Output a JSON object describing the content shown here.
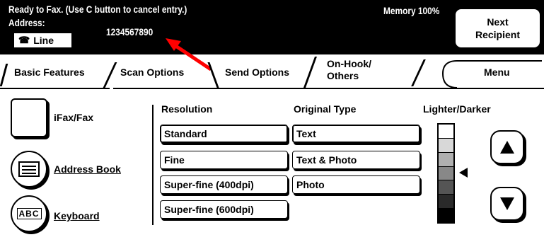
{
  "status": {
    "message": "Ready to Fax.  (Use C button to cancel entry.)",
    "memory": "Memory 100%",
    "address_label": "Address:",
    "address_value": "1234567890",
    "line_label": "Line",
    "next_recipient": "Next\nRecipient"
  },
  "tabs": [
    {
      "label": "Basic Features"
    },
    {
      "label": "Scan Options"
    },
    {
      "label": "Send Options"
    },
    {
      "label": "On-Hook/\nOthers"
    },
    {
      "label": "Menu"
    }
  ],
  "left": {
    "ifax": "iFax/Fax",
    "address_book": "Address Book",
    "keyboard": "Keyboard",
    "keyboard_icon_text": "ABC"
  },
  "resolution": {
    "title": "Resolution",
    "options": [
      "Standard",
      "Fine",
      "Super-fine (400dpi)",
      "Super-fine (600dpi)"
    ],
    "selected": "Standard"
  },
  "original_type": {
    "title": "Original Type",
    "options": [
      "Text",
      "Text & Photo",
      "Photo"
    ],
    "selected": "Text"
  },
  "density": {
    "title": "Lighter/Darker",
    "levels": 7,
    "selected_level": 4
  },
  "colors": {
    "background": "#ffffff",
    "bar": "#000000",
    "pointer": "#ff0000"
  }
}
